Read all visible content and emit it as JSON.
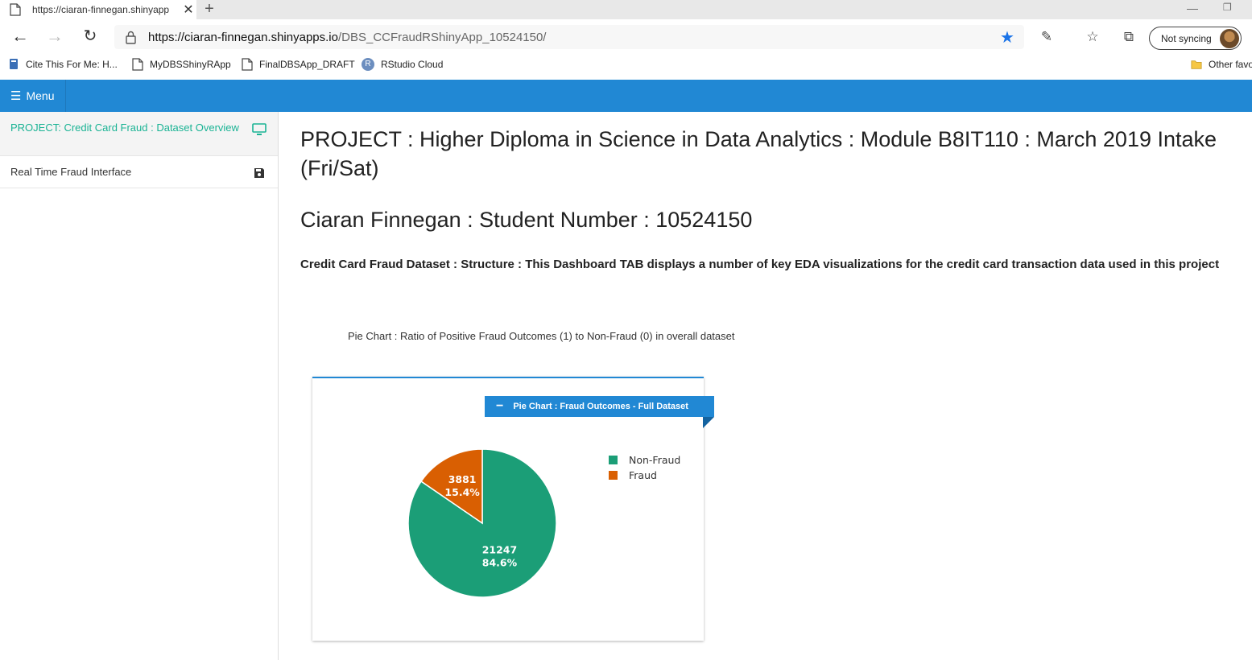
{
  "browser": {
    "tab_title": "https://ciaran-finnegan.shinyapp",
    "url_host": "https://ciaran-finnegan.shinyapps.io",
    "url_path": "/DBS_CCFraudRShinyApp_10524150/",
    "sync_label": "Not syncing",
    "bookmarks": [
      "Cite This For Me: H...",
      "MyDBSShinyRApp",
      "FinalDBSApp_DRAFT",
      "RStudio Cloud",
      "Other favo"
    ],
    "bookmark_r_glyph": "R"
  },
  "header": {
    "menu_label": "Menu",
    "color": "#2188d4"
  },
  "sidebar": {
    "items": [
      {
        "label": "PROJECT: Credit Card Fraud : Dataset Overview",
        "icon": "desktop-icon",
        "active": true
      },
      {
        "label": "Real Time Fraud Interface",
        "icon": "save-icon",
        "active": false
      }
    ]
  },
  "main": {
    "title": "PROJECT : Higher Diploma in Science in Data Analytics : Module B8IT110 : March 2019 Intake (Fri/Sat)",
    "student": "Ciaran Finnegan : Student Number : 10524150",
    "description": "Credit Card Fraud Dataset : Structure : This Dashboard TAB displays a number of key EDA visualizations for the credit card transaction data used in this project",
    "pie_caption": "Pie Chart : Ratio of Positive Fraud Outcomes (1) to Non-Fraud (0) in overall dataset",
    "box_title": "Pie Chart : Fraud Outcomes - Full Dataset"
  },
  "chart_data": {
    "type": "pie",
    "categories": [
      "Non-Fraud",
      "Fraud"
    ],
    "values": [
      21247,
      3881
    ],
    "labels": [
      "84.6%",
      "15.4%"
    ],
    "colors": [
      "#1b9e77",
      "#d95f02"
    ],
    "legend": "right"
  }
}
